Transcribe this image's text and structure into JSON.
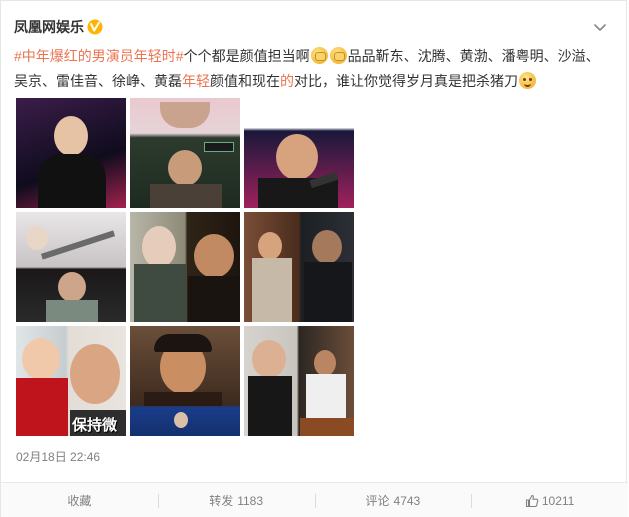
{
  "post": {
    "author": "凤凰网娱乐",
    "verified_icon": "verified-v-icon",
    "menu_icon": "chevron-down-icon",
    "text": {
      "hash_open": "#",
      "tag_part1": "中年爆红",
      "tag_part2": "的男演员",
      "tag_part3": "年轻",
      "tag_part4": "时",
      "hash_close": "#",
      "t1": "个个都是颜值担当啊",
      "t2": "品品靳东、沈腾、黄渤、潘粤明、沙溢、吴京、雷佳音、徐峥、黄磊",
      "t3": "年轻",
      "t4": "颜值和现在",
      "t5": "的",
      "t6": "对比，谁让你觉得岁月真是把杀猪刀"
    },
    "emojis": [
      "clap-emoji",
      "clap-emoji",
      "grin-emoji"
    ],
    "photo_overlay_text": "保持微",
    "timestamp": "02月18日 22:46"
  },
  "actions": {
    "favorite": {
      "label": "收藏"
    },
    "repost": {
      "label": "转发",
      "count": "1183"
    },
    "comment": {
      "label": "评论",
      "count": "4743"
    },
    "like": {
      "icon": "thumbs-up-icon",
      "count": "10211"
    }
  },
  "colors": {
    "accent": "#eb7350",
    "verified": "#ff8200",
    "muted": "#808080"
  }
}
